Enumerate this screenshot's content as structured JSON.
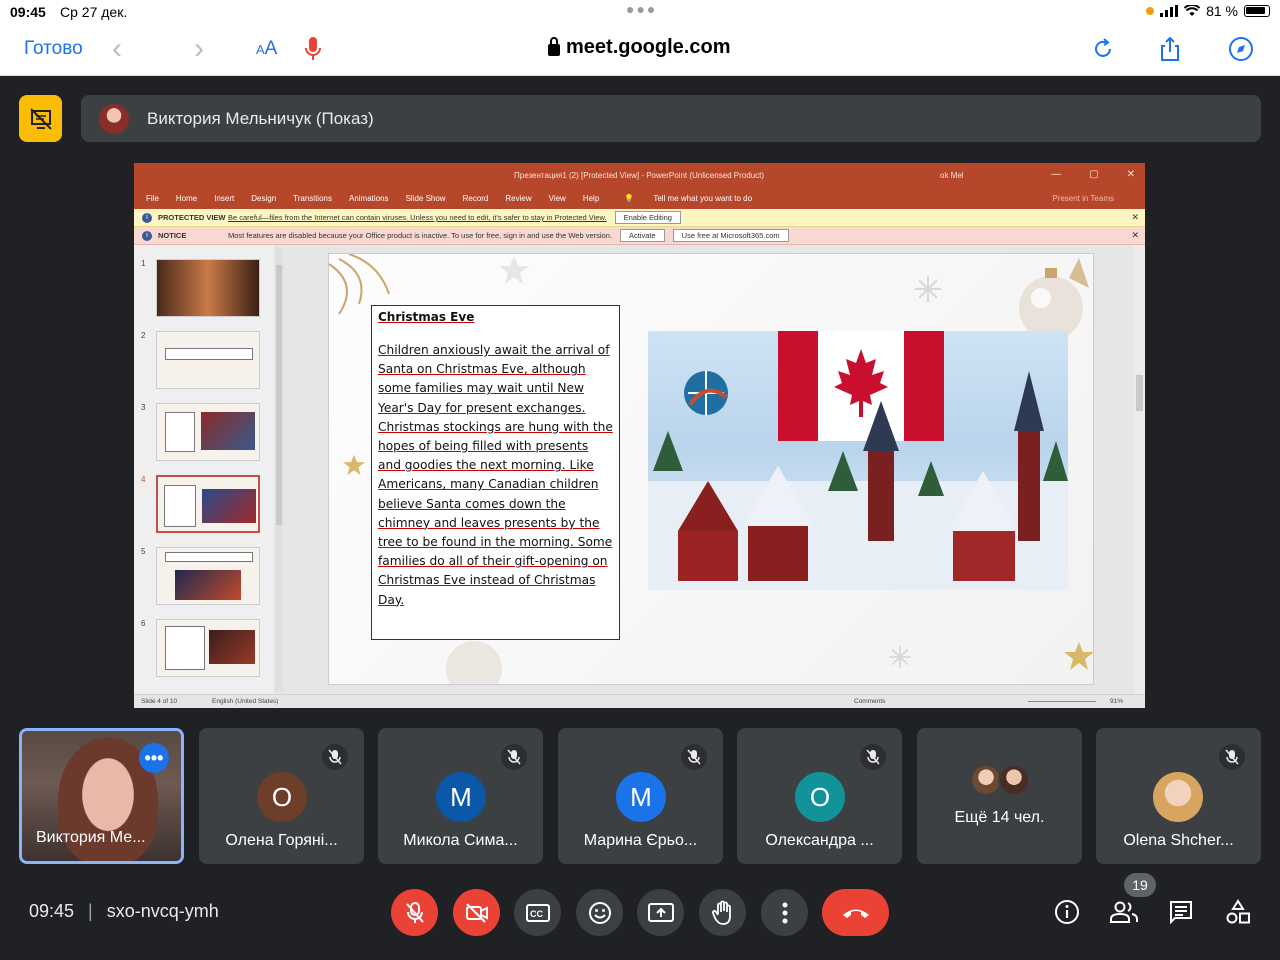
{
  "status": {
    "time": "09:45",
    "date": "Ср 27 дек.",
    "battery": "81 %"
  },
  "safari": {
    "done": "Готово",
    "aa": "AA",
    "url": "meet.google.com"
  },
  "presenter": {
    "name": "Виктория Мельничук (Показ)"
  },
  "ppt": {
    "title": "Презентация1 (2) [Protected View]  -  PowerPoint (Unlicensed Product)",
    "user": "ok Mel",
    "tabs": [
      "File",
      "Home",
      "Insert",
      "Design",
      "Transitions",
      "Animations",
      "Slide Show",
      "Record",
      "Review",
      "View",
      "Help"
    ],
    "tellme": "Tell me what you want to do",
    "share": "Present in Teams",
    "protected_label": "PROTECTED VIEW",
    "protected_msg": "Be careful—files from the Internet can contain viruses. Unless you need to edit, it's safer to stay in Protected View.",
    "enable_editing": "Enable Editing",
    "notice_label": "NOTICE",
    "notice_msg": "Most features are disabled because your Office product is inactive. To use for free, sign in and use the Web version.",
    "activate": "Activate",
    "use_free": "Use free at Microsoft365.com",
    "thumb_numbers": [
      "1",
      "2",
      "3",
      "4",
      "5",
      "6"
    ],
    "slide_heading": "Christmas Eve",
    "slide_body": "Children anxiously await the arrival of Santa on Christmas Eve, although some families may wait until New Year's Day for present exchanges. Christmas stockings are hung with the hopes of being filled with presents and goodies the next morning. Like Americans, many Canadian children believe Santa comes down the chimney and leaves presents by the tree to be found in the morning. Some families do all of their gift-opening on Christmas Eve instead of Christmas Day.",
    "status_slide": "Slide 4 of 10",
    "status_lang": "English (United States)",
    "status_comments": "Comments",
    "status_zoom": "91%"
  },
  "participants": [
    {
      "name": "Виктория Ме...",
      "initial": "",
      "color": ""
    },
    {
      "name": "Олена Горяні...",
      "initial": "О",
      "color": "#6d3f2a"
    },
    {
      "name": "Микола Сима...",
      "initial": "М",
      "color": "#0b57a8"
    },
    {
      "name": "Марина Єрьо...",
      "initial": "М",
      "color": "#1a73e8"
    },
    {
      "name": "Олександра ...",
      "initial": "О",
      "color": "#12939a"
    },
    {
      "name": "Ещё 14 чел.",
      "initial": "",
      "color": ""
    },
    {
      "name": "Olena Shcher...",
      "initial": "",
      "color": ""
    }
  ],
  "meeting": {
    "time": "09:45",
    "code": "sxo-nvcq-ymh",
    "people_count": "19"
  },
  "icons": [
    "mic-off-icon",
    "camera-off-icon",
    "captions-icon",
    "emoji-icon",
    "present-icon",
    "raise-hand-icon",
    "more-icon",
    "end-call-icon",
    "info-icon",
    "people-icon",
    "chat-icon",
    "activities-icon"
  ]
}
